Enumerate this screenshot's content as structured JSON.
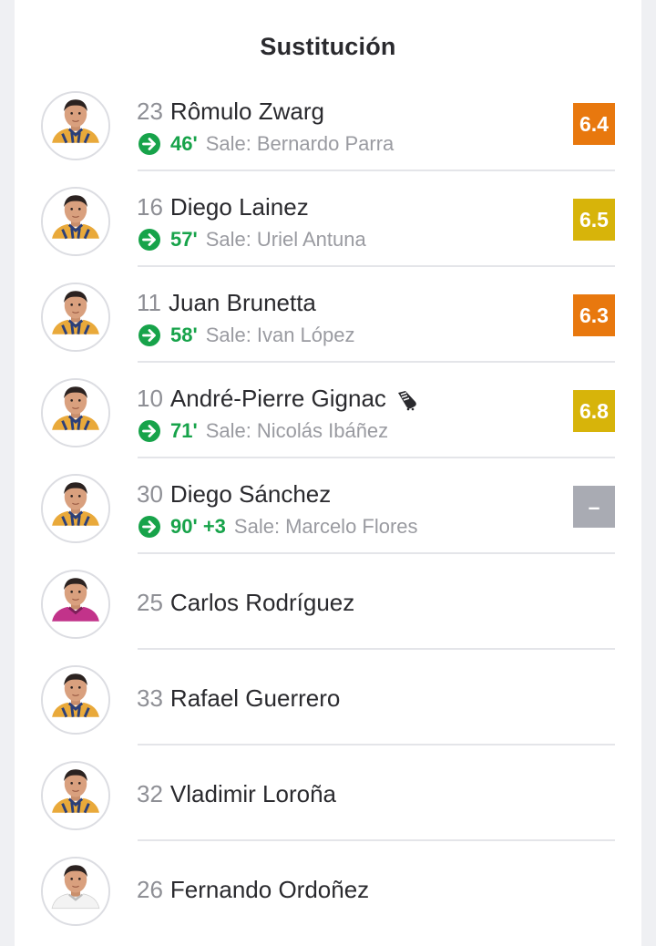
{
  "panel": {
    "title": "Sustitución"
  },
  "colors": {
    "rating_orange": "#e8780e",
    "rating_yellow": "#d7b40a",
    "rating_none": "#a9abb3",
    "sub_in_green": "#17a34a"
  },
  "players": [
    {
      "number": "23",
      "name": "Rômulo Zwarg",
      "has_sub": true,
      "minute": "46'",
      "sale_label": "Sale:",
      "sale_name": "Bernardo Parra",
      "rating": "6.4",
      "rating_color": "orange",
      "jersey": "tigres"
    },
    {
      "number": "16",
      "name": "Diego Lainez",
      "has_sub": true,
      "minute": "57'",
      "sale_label": "Sale:",
      "sale_name": "Uriel Antuna",
      "rating": "6.5",
      "rating_color": "yellow",
      "jersey": "tigres"
    },
    {
      "number": "11",
      "name": "Juan Brunetta",
      "has_sub": true,
      "minute": "58'",
      "sale_label": "Sale:",
      "sale_name": "Ivan López",
      "rating": "6.3",
      "rating_color": "orange",
      "jersey": "tigres"
    },
    {
      "number": "10",
      "name": "André-Pierre Gignac",
      "has_sub": true,
      "has_boot_icon": true,
      "minute": "71'",
      "sale_label": "Sale:",
      "sale_name": "Nicolás Ibáñez",
      "rating": "6.8",
      "rating_color": "yellow",
      "jersey": "tigres"
    },
    {
      "number": "30",
      "name": "Diego Sánchez",
      "has_sub": true,
      "minute": "90' +3",
      "sale_label": "Sale:",
      "sale_name": "Marcelo Flores",
      "rating": "–",
      "rating_color": "gray",
      "jersey": "tigres"
    },
    {
      "number": "25",
      "name": "Carlos Rodríguez",
      "has_sub": false,
      "jersey": "keeper"
    },
    {
      "number": "33",
      "name": "Rafael Guerrero",
      "has_sub": false,
      "jersey": "tigres"
    },
    {
      "number": "32",
      "name": "Vladimir Loroña",
      "has_sub": false,
      "jersey": "tigres"
    },
    {
      "number": "26",
      "name": "Fernando Ordoñez",
      "has_sub": false,
      "jersey": "white"
    }
  ]
}
